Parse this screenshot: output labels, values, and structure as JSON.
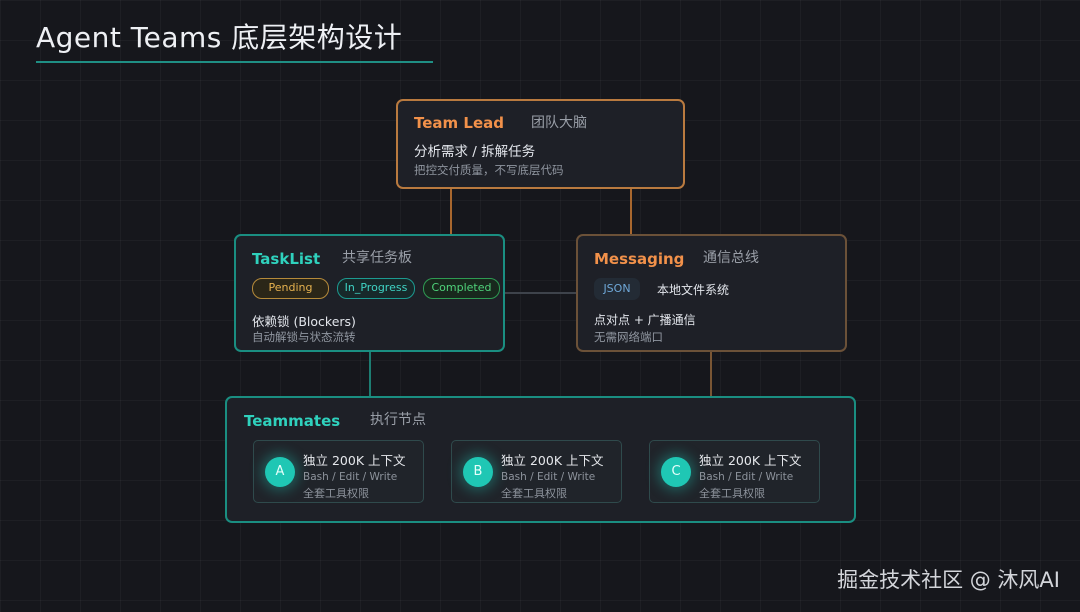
{
  "title": "Agent Teams 底层架构设计",
  "team_lead": {
    "title": "Team Lead",
    "subtitle": "团队大脑",
    "line1": "分析需求 / 拆解任务",
    "line2": "把控交付质量，不写底层代码"
  },
  "tasklist": {
    "title": "TaskList",
    "subtitle": "共享任务板",
    "statuses": [
      "Pending",
      "In_Progress",
      "Completed"
    ],
    "line1": "依赖锁 (Blockers)",
    "line2": "自动解锁与状态流转"
  },
  "messaging": {
    "title": "Messaging",
    "subtitle": "通信总线",
    "tag": "JSON",
    "tag_text": "本地文件系统",
    "line1": "点对点 + 广播通信",
    "line2": "无需网络端口"
  },
  "teammates": {
    "title": "Teammates",
    "subtitle": "执行节点",
    "members": [
      {
        "avatar": "A",
        "line1": "独立 200K 上下文",
        "line2": "Bash / Edit / Write",
        "line3": "全套工具权限"
      },
      {
        "avatar": "B",
        "line1": "独立 200K 上下文",
        "line2": "Bash / Edit / Write",
        "line3": "全套工具权限"
      },
      {
        "avatar": "C",
        "line1": "独立 200K 上下文",
        "line2": "Bash / Edit / Write",
        "line3": "全套工具权限"
      }
    ]
  },
  "watermark": "掘金技术社区 @ 沐风AI",
  "colors": {
    "background": "#16171c",
    "orange": "#f2914a",
    "teal": "#2fd1bd",
    "pending": "#e7b24f",
    "in_progress": "#3fd3c4",
    "completed": "#4fd27a"
  }
}
